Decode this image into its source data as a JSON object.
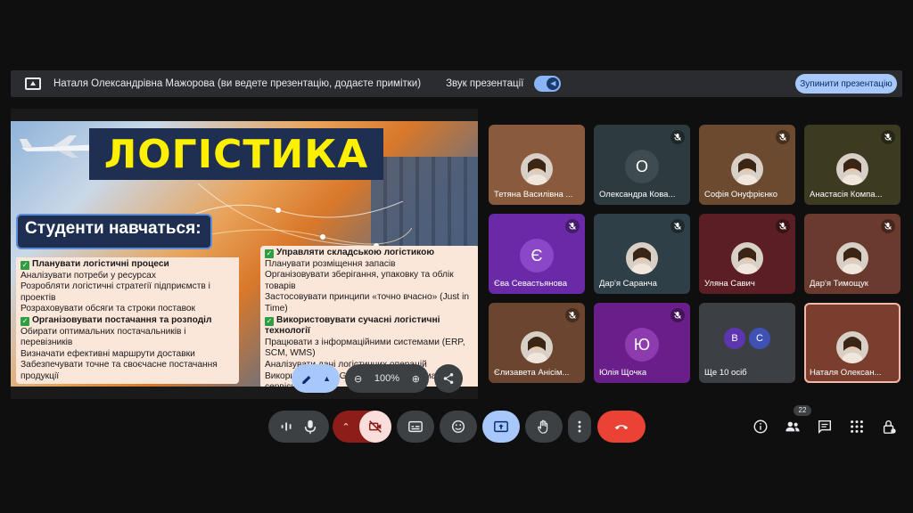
{
  "present_bar": {
    "text": "Наталя Олександрівна Мажорова (ви ведете презентацію, додаєте примітки)",
    "sound_label": "Звук презентації",
    "stop_button": "Зупинити презентацію"
  },
  "slide": {
    "title": "ЛОГІСТИКА",
    "subtitle": "Студенти навчаться:",
    "left": [
      {
        "text": "Планувати логістичні процеси",
        "heading": true
      },
      {
        "text": "Аналізувати потреби у ресурсах",
        "heading": false
      },
      {
        "text": "Розробляти логістичні стратегії підприємств і проектів",
        "heading": false
      },
      {
        "text": "Розраховувати обсяги та строки поставок",
        "heading": false
      },
      {
        "text": "Організовувати постачання та розподіл",
        "heading": true
      },
      {
        "text": "Обирати оптимальних постачальників і перевізників",
        "heading": false
      },
      {
        "text": "Визначати ефективні маршрути доставки",
        "heading": false
      },
      {
        "text": "Забезпечувати точне та своєчасне постачання продукції",
        "heading": false
      }
    ],
    "right": [
      {
        "text": "Управляти складською логістикою",
        "heading": true
      },
      {
        "text": "Планувати розміщення запасів",
        "heading": false
      },
      {
        "text": "Організовувати зберігання, упаковку та облік товарів",
        "heading": false
      },
      {
        "text": "Застосовувати принципи «точно вчасно» (Just in Time)",
        "heading": false
      },
      {
        "text": "Використовувати сучасні логістичні технології",
        "heading": true
      },
      {
        "text": "Працювати з інформаційними системами (ERP, SCM, WMS)",
        "heading": false
      },
      {
        "text": "Аналізувати дані логістичних операцій",
        "heading": false
      },
      {
        "text": "Використовувати GPS-трекінг, RFID, хмарні сервіси",
        "heading": false
      }
    ],
    "zoom": "100%"
  },
  "participants": [
    {
      "name": "Тетяна Василівна ...",
      "kind": "photo",
      "bg": "#8a5a3c",
      "muted": false
    },
    {
      "name": "Олександра Кова...",
      "kind": "letter",
      "letter": "О",
      "bg": "#2d3b40",
      "circle": "#3e4c52",
      "muted": true
    },
    {
      "name": "Софія Онуфрієнко",
      "kind": "photo",
      "bg": "#6b4a30",
      "muted": true
    },
    {
      "name": "Анастасія Компа...",
      "kind": "photo",
      "bg": "#3d3a22",
      "muted": true
    },
    {
      "name": "Єва Севастьянова",
      "kind": "letter",
      "letter": "Є",
      "bg": "#6a2aa8",
      "circle": "#8a48c8",
      "muted": true
    },
    {
      "name": "Дар'я Саранча",
      "kind": "photo",
      "bg": "#2f3f48",
      "muted": true
    },
    {
      "name": "Уляна Савич",
      "kind": "photo",
      "bg": "#5a1e24",
      "muted": true
    },
    {
      "name": "Дар'я Тимощук",
      "kind": "photo",
      "bg": "#6b3a2e",
      "muted": true
    },
    {
      "name": "Єлизавета Анісім...",
      "kind": "photo",
      "bg": "#6b4530",
      "muted": true
    },
    {
      "name": "Юлія Щочка",
      "kind": "letter",
      "letter": "Ю",
      "bg": "#6a1e8a",
      "circle": "#8e3bb0",
      "muted": true
    },
    {
      "name": "Ще 10 осіб",
      "kind": "more",
      "letters": [
        "В",
        "С"
      ],
      "bg": "#3c3f44",
      "muted": false
    },
    {
      "name": "Наталя Олексан...",
      "kind": "photo",
      "bg": "#7a3e2e",
      "muted": false,
      "highlight": true
    }
  ],
  "people_count": "22",
  "colors": {
    "end_call": "#ea4335",
    "present_active": "#a8c7fa",
    "cam_off": "#f9dedc"
  }
}
